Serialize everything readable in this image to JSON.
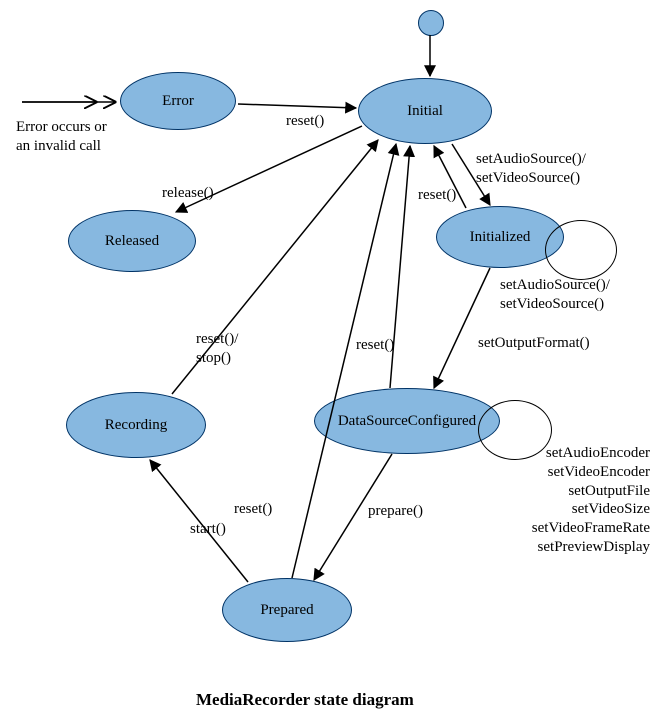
{
  "caption": "MediaRecorder state diagram",
  "states": {
    "error": "Error",
    "initial": "Initial",
    "released": "Released",
    "initialized": "Initialized",
    "recording": "Recording",
    "dsc": "DataSourceConfigured",
    "prepared": "Prepared"
  },
  "labels": {
    "error_cause": "Error occurs or\nan invalid call",
    "reset_error": "reset()",
    "release": "release()",
    "set_src_to_init": "setAudioSource()/\nsetVideoSource()",
    "reset_from_init": "reset()",
    "init_loop": "setAudioSource()/\nsetVideoSource()",
    "set_output_format": "setOutputFormat()",
    "reset_from_dsc": "reset()",
    "dsc_loop": "setAudioEncoder()\nsetVideoEncoder()\nsetOutputFile()\nsetVideoSize()\nsetVideoFrameRate()\nsetPreviewDisplay()",
    "prepare": "prepare()",
    "reset_from_prepared": "reset()",
    "start": "start()",
    "reset_stop": "reset()/\nstop()"
  }
}
